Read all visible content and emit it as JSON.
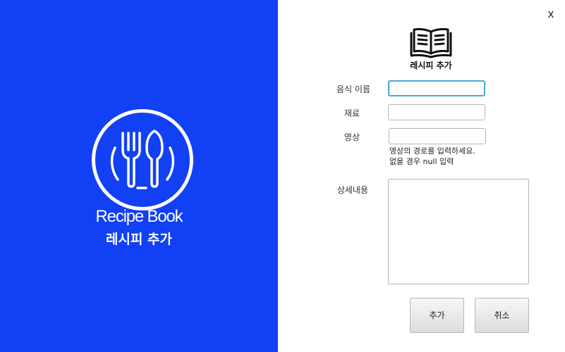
{
  "brand": {
    "name": "Recipe Book",
    "subtitle": "레시피 추가",
    "icon": "fork-spoon-plate-icon",
    "color": "#1240f5"
  },
  "window": {
    "close_label": "x"
  },
  "form": {
    "header_icon": "open-book-icon",
    "title": "레시피 추가",
    "fields": {
      "name": {
        "label": "음식 이름",
        "value": ""
      },
      "ingredients": {
        "label": "재료",
        "value": ""
      },
      "video": {
        "label": "영상",
        "value": "",
        "hint_line1": "영상의 경로를 입력하세요.",
        "hint_line2": "없을 경우 null 입력"
      },
      "details": {
        "label": "상세내용",
        "value": ""
      }
    },
    "buttons": {
      "add": "추가",
      "cancel": "취소"
    }
  }
}
